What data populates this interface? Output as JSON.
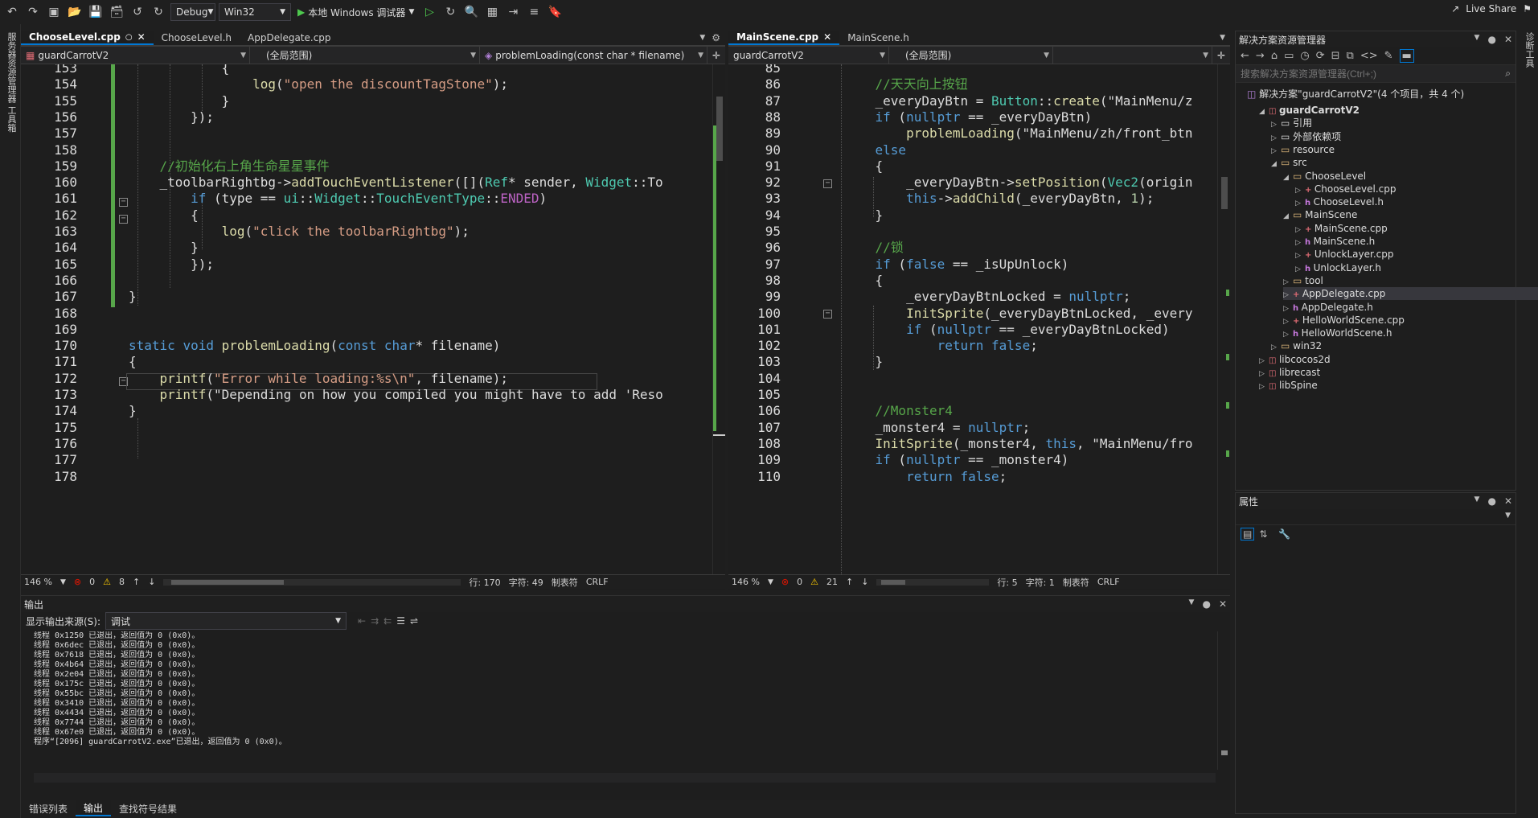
{
  "toolbar": {
    "config": "Debug",
    "platform": "Win32",
    "run_label": "本地 Windows 调试器",
    "live_share": "Live Share"
  },
  "left_tool_label": "服务器资源管理器 工具箱",
  "right_tool_label": "诊断工具",
  "editor_left": {
    "tabs": [
      {
        "label": "ChooseLevel.cpp",
        "active": true
      },
      {
        "label": "ChooseLevel.h",
        "active": false
      },
      {
        "label": "AppDelegate.cpp",
        "active": false
      }
    ],
    "nav": {
      "project": "guardCarrotV2",
      "scope": "(全局范围)",
      "member": "problemLoading(const char * filename)"
    },
    "lines": [
      {
        "n": "153",
        "text": "            {"
      },
      {
        "n": "154",
        "text": "                log(\"open the discountTagStone\");"
      },
      {
        "n": "155",
        "text": "            }"
      },
      {
        "n": "156",
        "text": "        });"
      },
      {
        "n": "157",
        "text": ""
      },
      {
        "n": "158",
        "text": ""
      },
      {
        "n": "159",
        "text": "    //初始化右上角生命星星事件"
      },
      {
        "n": "160",
        "text": "    _toolbarRightbg->addTouchEventListener([](Ref* sender, Widget::To"
      },
      {
        "n": "161",
        "text": "        if (type == ui::Widget::TouchEventType::ENDED)"
      },
      {
        "n": "162",
        "text": "        {"
      },
      {
        "n": "163",
        "text": "            log(\"click the toolbarRightbg\");"
      },
      {
        "n": "164",
        "text": "        }"
      },
      {
        "n": "165",
        "text": "        });"
      },
      {
        "n": "166",
        "text": ""
      },
      {
        "n": "167",
        "text": "}"
      },
      {
        "n": "168",
        "text": ""
      },
      {
        "n": "169",
        "text": ""
      },
      {
        "n": "170",
        "text": "static void problemLoading(const char* filename)"
      },
      {
        "n": "171",
        "text": "{"
      },
      {
        "n": "172",
        "text": "    printf(\"Error while loading:%s\\n\", filename);"
      },
      {
        "n": "173",
        "text": "    printf(\"Depending on how you compiled you might have to add 'Reso"
      },
      {
        "n": "174",
        "text": "}"
      },
      {
        "n": "175",
        "text": ""
      },
      {
        "n": "176",
        "text": ""
      },
      {
        "n": "177",
        "text": ""
      },
      {
        "n": "178",
        "text": ""
      }
    ],
    "status": {
      "zoom": "146 %",
      "errors": "0",
      "warnings": "8",
      "line": "行: 170",
      "char": "字符: 49",
      "tabs": "制表符",
      "eol": "CRLF"
    }
  },
  "editor_right": {
    "tabs": [
      {
        "label": "MainScene.cpp",
        "active": true
      },
      {
        "label": "MainScene.h",
        "active": false
      }
    ],
    "nav": {
      "project": "guardCarrotV2",
      "scope": "(全局范围)",
      "member": ""
    },
    "lines": [
      {
        "n": "85",
        "text": ""
      },
      {
        "n": "86",
        "text": "    //天天向上按钮"
      },
      {
        "n": "87",
        "text": "    _everyDayBtn = Button::create(\"MainMenu/z"
      },
      {
        "n": "88",
        "text": "    if (nullptr == _everyDayBtn)"
      },
      {
        "n": "89",
        "text": "        problemLoading(\"MainMenu/zh/front_btn"
      },
      {
        "n": "90",
        "text": "    else"
      },
      {
        "n": "91",
        "text": "    {"
      },
      {
        "n": "92",
        "text": "        _everyDayBtn->setPosition(Vec2(origin"
      },
      {
        "n": "93",
        "text": "        this->addChild(_everyDayBtn, 1);"
      },
      {
        "n": "94",
        "text": "    }"
      },
      {
        "n": "95",
        "text": ""
      },
      {
        "n": "96",
        "text": "    //锁"
      },
      {
        "n": "97",
        "text": "    if (false == _isUpUnlock)"
      },
      {
        "n": "98",
        "text": "    {"
      },
      {
        "n": "99",
        "text": "        _everyDayBtnLocked = nullptr;"
      },
      {
        "n": "100",
        "text": "        InitSprite(_everyDayBtnLocked, _every"
      },
      {
        "n": "101",
        "text": "        if (nullptr == _everyDayBtnLocked)"
      },
      {
        "n": "102",
        "text": "            return false;"
      },
      {
        "n": "103",
        "text": "    }"
      },
      {
        "n": "104",
        "text": ""
      },
      {
        "n": "105",
        "text": ""
      },
      {
        "n": "106",
        "text": "    //Monster4"
      },
      {
        "n": "107",
        "text": "    _monster4 = nullptr;"
      },
      {
        "n": "108",
        "text": "    InitSprite(_monster4, this, \"MainMenu/fro"
      },
      {
        "n": "109",
        "text": "    if (nullptr == _monster4)"
      },
      {
        "n": "110",
        "text": "        return false;"
      }
    ],
    "status": {
      "zoom": "146 %",
      "errors": "0",
      "warnings": "21",
      "line": "行: 5",
      "char": "字符: 1",
      "tabs": "制表符",
      "eol": "CRLF"
    }
  },
  "solution": {
    "title": "解决方案资源管理器",
    "search_placeholder": "搜索解决方案资源管理器(Ctrl+;)",
    "root": "解决方案\"guardCarrotV2\"(4 个项目，共 4 个)",
    "items": [
      {
        "label": "guardCarrotV2",
        "depth": 1,
        "icon": "project",
        "exp": "open",
        "bold": true
      },
      {
        "label": "引用",
        "depth": 2,
        "icon": "ref",
        "exp": "closed"
      },
      {
        "label": "外部依赖项",
        "depth": 2,
        "icon": "ext",
        "exp": "closed"
      },
      {
        "label": "resource",
        "depth": 2,
        "icon": "folder",
        "exp": "closed"
      },
      {
        "label": "src",
        "depth": 2,
        "icon": "folder",
        "exp": "open"
      },
      {
        "label": "ChooseLevel",
        "depth": 3,
        "icon": "folder",
        "exp": "open"
      },
      {
        "label": "ChooseLevel.cpp",
        "depth": 4,
        "icon": "cpp",
        "exp": "closed"
      },
      {
        "label": "ChooseLevel.h",
        "depth": 4,
        "icon": "h",
        "exp": "closed"
      },
      {
        "label": "MainScene",
        "depth": 3,
        "icon": "folder",
        "exp": "open"
      },
      {
        "label": "MainScene.cpp",
        "depth": 4,
        "icon": "cpp",
        "exp": "closed"
      },
      {
        "label": "MainScene.h",
        "depth": 4,
        "icon": "h",
        "exp": "closed"
      },
      {
        "label": "UnlockLayer.cpp",
        "depth": 4,
        "icon": "cpp",
        "exp": "closed"
      },
      {
        "label": "UnlockLayer.h",
        "depth": 4,
        "icon": "h",
        "exp": "closed"
      },
      {
        "label": "tool",
        "depth": 3,
        "icon": "folder",
        "exp": "closed"
      },
      {
        "label": "AppDelegate.cpp",
        "depth": 3,
        "icon": "cpp",
        "exp": "closed",
        "selected": true
      },
      {
        "label": "AppDelegate.h",
        "depth": 3,
        "icon": "h",
        "exp": "closed"
      },
      {
        "label": "HelloWorldScene.cpp",
        "depth": 3,
        "icon": "cpp",
        "exp": "closed"
      },
      {
        "label": "HelloWorldScene.h",
        "depth": 3,
        "icon": "h",
        "exp": "closed"
      },
      {
        "label": "win32",
        "depth": 2,
        "icon": "folder",
        "exp": "closed"
      },
      {
        "label": "libcocos2d",
        "depth": 1,
        "icon": "project",
        "exp": "closed"
      },
      {
        "label": "librecast",
        "depth": 1,
        "icon": "project",
        "exp": "closed"
      },
      {
        "label": "libSpine",
        "depth": 1,
        "icon": "project",
        "exp": "closed"
      }
    ]
  },
  "properties": {
    "title": "属性"
  },
  "output": {
    "title": "输出",
    "source_label": "显示输出来源(S):",
    "source_value": "调试",
    "lines": [
      "线程 0x1250 已退出，返回值为 0 (0x0)。",
      "线程 0x6dec 已退出，返回值为 0 (0x0)。",
      "线程 0x7618 已退出，返回值为 0 (0x0)。",
      "线程 0x4b64 已退出，返回值为 0 (0x0)。",
      "线程 0x2e04 已退出，返回值为 0 (0x0)。",
      "线程 0x175c 已退出，返回值为 0 (0x0)。",
      "线程 0x55bc 已退出，返回值为 0 (0x0)。",
      "线程 0x3410 已退出，返回值为 0 (0x0)。",
      "线程 0x4434 已退出，返回值为 0 (0x0)。",
      "线程 0x7744 已退出，返回值为 0 (0x0)。",
      "线程 0x67e0 已退出，返回值为 0 (0x0)。",
      "程序“[2096] guardCarrotV2.exe”已退出，返回值为 0 (0x0)。"
    ]
  },
  "bottom_tabs": [
    "错误列表",
    "输出",
    "查找符号结果"
  ],
  "colors": {
    "accent": "#0078d4",
    "bg": "#1e1e1e",
    "change_bar": "#57a64a"
  }
}
